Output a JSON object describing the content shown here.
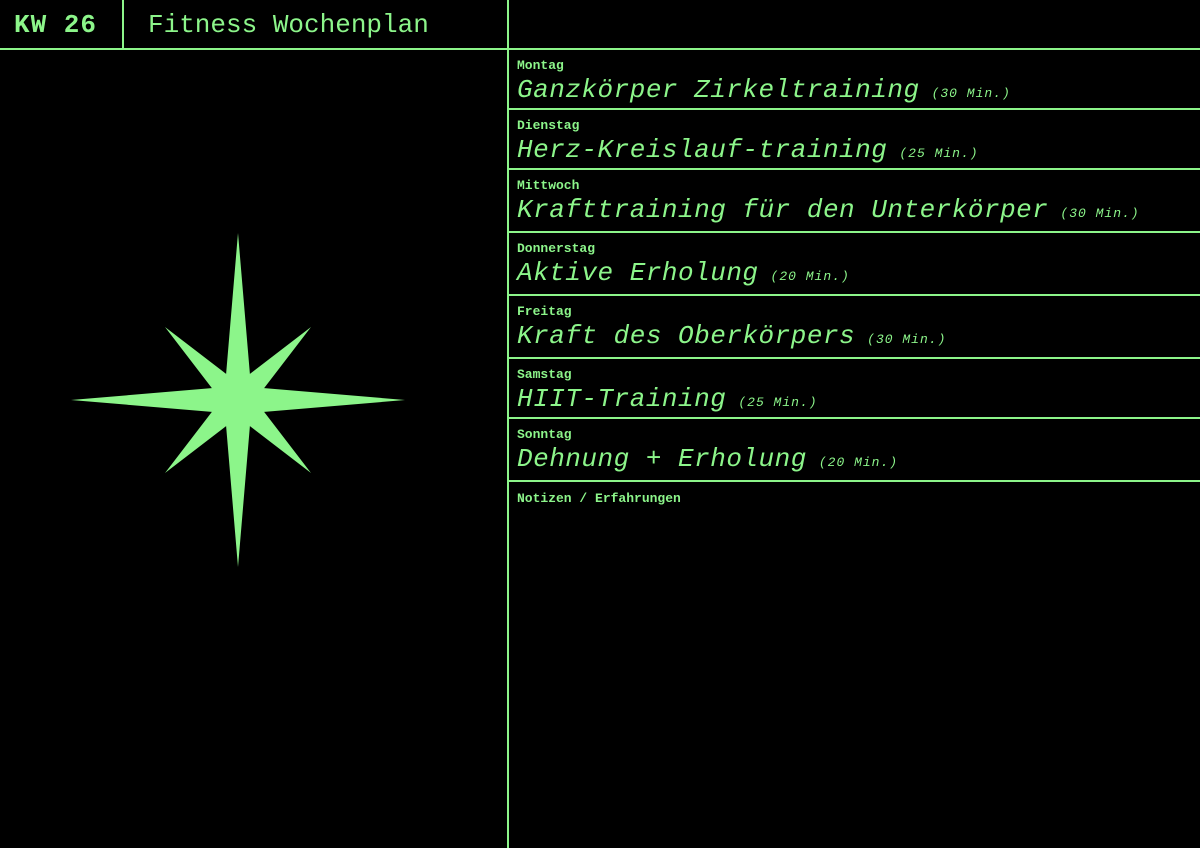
{
  "header": {
    "week": "KW 26",
    "title": "Fitness Wochenplan"
  },
  "colors": {
    "background": "#000000",
    "accent": "#8cf58a"
  },
  "decoration": {
    "icon": "eight-point-star-icon"
  },
  "days": [
    {
      "name": "Montag",
      "workout": "Ganzkörper Zirkeltraining",
      "duration": "(30 Min.)"
    },
    {
      "name": "Dienstag",
      "workout": "Herz-Kreislauf-training",
      "duration": "(25 Min.)"
    },
    {
      "name": "Mittwoch",
      "workout": "Krafttraining für den Unterkörper",
      "duration": "(30 Min.)"
    },
    {
      "name": "Donnerstag",
      "workout": "Aktive Erholung",
      "duration": "(20 Min.)"
    },
    {
      "name": "Freitag",
      "workout": "Kraft des Oberkörpers",
      "duration": "(30 Min.)"
    },
    {
      "name": "Samstag",
      "workout": "HIIT-Training",
      "duration": "(25 Min.)"
    },
    {
      "name": "Sonntag",
      "workout": "Dehnung + Erholung",
      "duration": "(20 Min.)"
    }
  ],
  "notes": {
    "label": "Notizen / Erfahrungen"
  }
}
